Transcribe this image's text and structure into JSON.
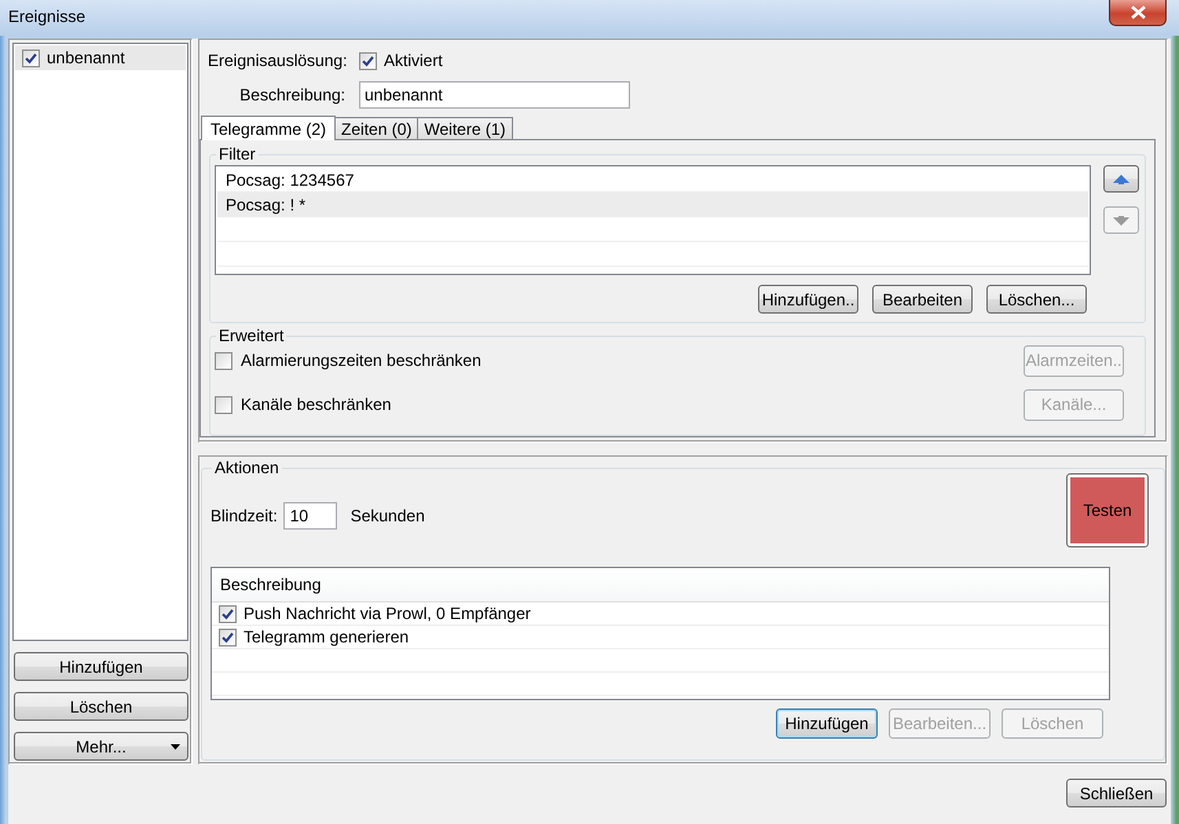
{
  "window": {
    "title": "Ereignisse"
  },
  "events": {
    "items": [
      {
        "label": "unbenannt",
        "checked": true,
        "selected": true
      }
    ],
    "buttons": [
      {
        "label": "Hinzufügen",
        "kind": "plain"
      },
      {
        "label": "Löschen",
        "kind": "plain"
      },
      {
        "label": "Mehr...",
        "kind": "dropdown"
      }
    ]
  },
  "trigger": {
    "label": "Ereignisauslösung:",
    "checkbox": {
      "label": "Aktiviert",
      "checked": true
    }
  },
  "description": {
    "label": "Beschreibung:",
    "value": "unbenannt"
  },
  "tabs": [
    {
      "label": "Telegramme (2)",
      "selected": true
    },
    {
      "label": "Zeiten (0)",
      "selected": false
    },
    {
      "label": "Weitere (1)",
      "selected": false
    }
  ],
  "filter": {
    "title": "Filter",
    "rows": [
      {
        "text": "Pocsag: 1234567",
        "selected": false
      },
      {
        "text": "Pocsag: ! *",
        "selected": true
      }
    ],
    "move_buttons": [
      {
        "kind": "up",
        "disabled": false
      },
      {
        "kind": "down",
        "disabled": true
      }
    ],
    "buttons": [
      {
        "label": "Hinzufügen..",
        "disabled": false
      },
      {
        "label": "Bearbeiten",
        "disabled": false
      },
      {
        "label": "Löschen...",
        "disabled": false
      }
    ]
  },
  "advanced": {
    "title": "Erweitert",
    "options": [
      {
        "label": "Alarmierungszeiten beschränken",
        "checked": false,
        "button": {
          "label": "Alarmzeiten..",
          "disabled": true
        }
      },
      {
        "label": "Kanäle beschränken",
        "checked": false,
        "button": {
          "label": "Kanäle...",
          "disabled": true
        }
      }
    ]
  },
  "actions": {
    "title": "Aktionen",
    "blind_time": {
      "label": "Blindzeit:",
      "value": "10",
      "unit": "Sekunden"
    },
    "test_button": {
      "label": "Testen",
      "color": "#d05a5a"
    },
    "table": {
      "columns": [
        "Beschreibung"
      ],
      "rows": [
        {
          "text": "Push Nachricht via Prowl, 0 Empfänger",
          "checked": true
        },
        {
          "text": "Telegramm generieren",
          "checked": true
        }
      ]
    },
    "buttons": [
      {
        "label": "Hinzufügen",
        "disabled": false,
        "focused": true
      },
      {
        "label": "Bearbeiten...",
        "disabled": true,
        "focused": false
      },
      {
        "label": "Löschen",
        "disabled": true,
        "focused": false
      }
    ]
  },
  "close_button": {
    "label": "Schließen"
  }
}
